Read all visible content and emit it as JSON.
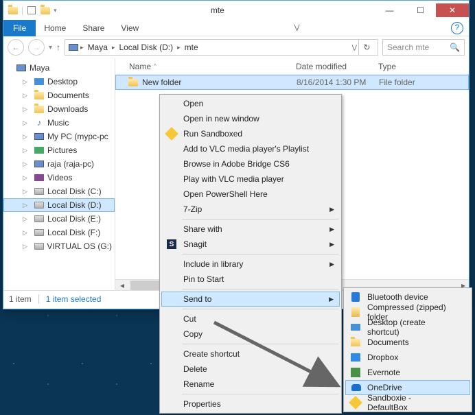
{
  "window": {
    "title": "mte"
  },
  "ribbon": {
    "file": "File",
    "tabs": [
      "Home",
      "Share",
      "View"
    ]
  },
  "breadcrumb": {
    "items": [
      "Maya",
      "Local Disk (D:)",
      "mte"
    ]
  },
  "search": {
    "placeholder": "Search mte"
  },
  "tree": {
    "root": "Maya",
    "items": [
      {
        "label": "Desktop",
        "icon": "desktop"
      },
      {
        "label": "Documents",
        "icon": "folder"
      },
      {
        "label": "Downloads",
        "icon": "folder"
      },
      {
        "label": "Music",
        "icon": "music"
      },
      {
        "label": "My PC (mypc-pc",
        "icon": "pc"
      },
      {
        "label": "Pictures",
        "icon": "pictures"
      },
      {
        "label": "raja (raja-pc)",
        "icon": "pc"
      },
      {
        "label": "Videos",
        "icon": "videos"
      },
      {
        "label": "Local Disk (C:)",
        "icon": "drive"
      },
      {
        "label": "Local Disk (D:)",
        "icon": "drive",
        "selected": true
      },
      {
        "label": "Local Disk (E:)",
        "icon": "drive"
      },
      {
        "label": "Local Disk (F:)",
        "icon": "drive"
      },
      {
        "label": "VIRTUAL OS (G:)",
        "icon": "drive"
      }
    ]
  },
  "columns": {
    "name": "Name",
    "date": "Date modified",
    "type": "Type"
  },
  "rows": [
    {
      "name": "New folder",
      "date": "8/16/2014 1:30 PM",
      "type": "File folder",
      "selected": true
    }
  ],
  "status": {
    "count": "1 item",
    "selection": "1 item selected"
  },
  "context_menu": {
    "groups": [
      [
        {
          "label": "Open"
        },
        {
          "label": "Open in new window"
        },
        {
          "label": "Run Sandboxed",
          "icon": "sandboxie"
        },
        {
          "label": "Add to VLC media player's Playlist"
        },
        {
          "label": "Browse in Adobe Bridge CS6"
        },
        {
          "label": "Play with VLC media player"
        },
        {
          "label": "Open PowerShell Here"
        },
        {
          "label": "7-Zip",
          "submenu": true
        }
      ],
      [
        {
          "label": "Share with",
          "submenu": true
        },
        {
          "label": "Snagit",
          "icon": "snagit",
          "submenu": true
        }
      ],
      [
        {
          "label": "Include in library",
          "submenu": true
        },
        {
          "label": "Pin to Start"
        }
      ],
      [
        {
          "label": "Send to",
          "submenu": true,
          "highlighted": true
        }
      ],
      [
        {
          "label": "Cut"
        },
        {
          "label": "Copy"
        }
      ],
      [
        {
          "label": "Create shortcut"
        },
        {
          "label": "Delete"
        },
        {
          "label": "Rename"
        }
      ],
      [
        {
          "label": "Properties"
        }
      ]
    ]
  },
  "submenu": {
    "items": [
      {
        "label": "Bluetooth device",
        "icon": "bluetooth"
      },
      {
        "label": "Compressed (zipped) folder",
        "icon": "zip"
      },
      {
        "label": "Desktop (create shortcut)",
        "icon": "desktop"
      },
      {
        "label": "Documents",
        "icon": "folder"
      },
      {
        "label": "Dropbox",
        "icon": "dropbox"
      },
      {
        "label": "Evernote",
        "icon": "evernote"
      },
      {
        "label": "OneDrive",
        "icon": "onedrive",
        "highlighted": true
      },
      {
        "label": "Sandboxie - DefaultBox",
        "icon": "sandboxie"
      }
    ]
  }
}
